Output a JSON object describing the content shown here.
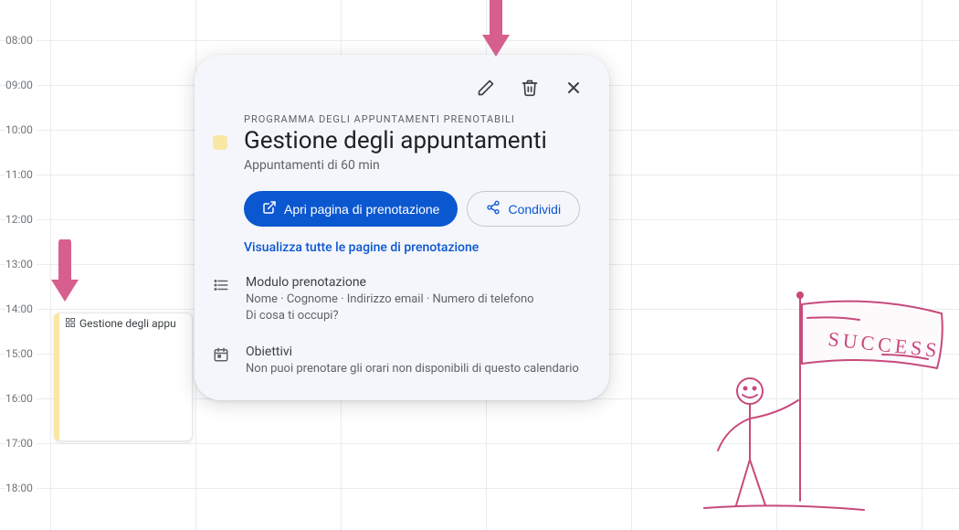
{
  "calendar": {
    "hours": [
      "08:00",
      "09:00",
      "10:00",
      "11:00",
      "12:00",
      "13:00",
      "14:00",
      "15:00",
      "16:00",
      "17:00",
      "18:00"
    ]
  },
  "event": {
    "title": "Gestione degli appu"
  },
  "popup": {
    "eyebrow": "PROGRAMMA DEGLI APPUNTAMENTI PRENOTABILI",
    "title": "Gestione degli appuntamenti",
    "subtitle": "Appuntamenti di 60 min",
    "open_button": "Apri pagina di prenotazione",
    "share_button": "Condividi",
    "view_all_link": "Visualizza tutte le pagine di prenotazione",
    "form": {
      "heading": "Modulo prenotazione",
      "line1": "Nome · Cognome · Indirizzo email · Numero di telefono",
      "line2": "Di cosa ti occupi?"
    },
    "goals": {
      "heading": "Obiettivi",
      "line1": "Non puoi prenotare gli orari non disponibili di questo calendario"
    }
  },
  "doodle": {
    "flag_text": "SUCCESS"
  }
}
